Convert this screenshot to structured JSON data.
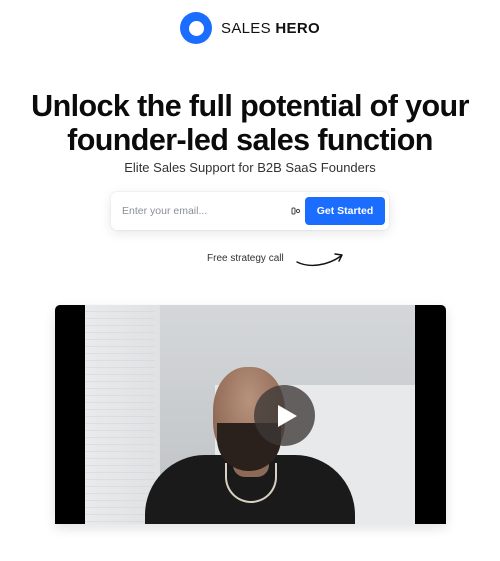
{
  "brand": {
    "name_light": "SALES ",
    "name_bold": "HERO",
    "logo_color": "#1a6dff"
  },
  "hero": {
    "headline_line1": "Unlock the full potential of your",
    "headline_line2": "founder-led sales function",
    "subheadline": "Elite Sales Support for B2B SaaS Founders"
  },
  "signup": {
    "email_placeholder": "Enter your email...",
    "email_value": "",
    "button_label": "Get Started",
    "button_color": "#1a6dff"
  },
  "callout": {
    "text": "Free strategy call"
  },
  "video": {
    "play_icon": "play-icon"
  }
}
